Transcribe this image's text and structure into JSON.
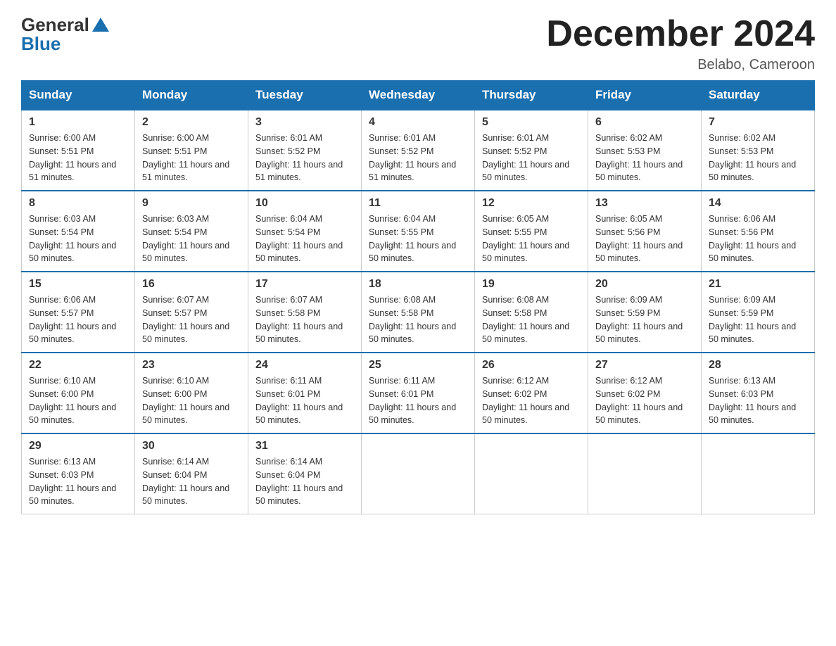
{
  "logo": {
    "general": "General",
    "blue": "Blue"
  },
  "title": "December 2024",
  "location": "Belabo, Cameroon",
  "days_of_week": [
    "Sunday",
    "Monday",
    "Tuesday",
    "Wednesday",
    "Thursday",
    "Friday",
    "Saturday"
  ],
  "weeks": [
    [
      {
        "day": "1",
        "sunrise": "6:00 AM",
        "sunset": "5:51 PM",
        "daylight": "11 hours and 51 minutes."
      },
      {
        "day": "2",
        "sunrise": "6:00 AM",
        "sunset": "5:51 PM",
        "daylight": "11 hours and 51 minutes."
      },
      {
        "day": "3",
        "sunrise": "6:01 AM",
        "sunset": "5:52 PM",
        "daylight": "11 hours and 51 minutes."
      },
      {
        "day": "4",
        "sunrise": "6:01 AM",
        "sunset": "5:52 PM",
        "daylight": "11 hours and 51 minutes."
      },
      {
        "day": "5",
        "sunrise": "6:01 AM",
        "sunset": "5:52 PM",
        "daylight": "11 hours and 50 minutes."
      },
      {
        "day": "6",
        "sunrise": "6:02 AM",
        "sunset": "5:53 PM",
        "daylight": "11 hours and 50 minutes."
      },
      {
        "day": "7",
        "sunrise": "6:02 AM",
        "sunset": "5:53 PM",
        "daylight": "11 hours and 50 minutes."
      }
    ],
    [
      {
        "day": "8",
        "sunrise": "6:03 AM",
        "sunset": "5:54 PM",
        "daylight": "11 hours and 50 minutes."
      },
      {
        "day": "9",
        "sunrise": "6:03 AM",
        "sunset": "5:54 PM",
        "daylight": "11 hours and 50 minutes."
      },
      {
        "day": "10",
        "sunrise": "6:04 AM",
        "sunset": "5:54 PM",
        "daylight": "11 hours and 50 minutes."
      },
      {
        "day": "11",
        "sunrise": "6:04 AM",
        "sunset": "5:55 PM",
        "daylight": "11 hours and 50 minutes."
      },
      {
        "day": "12",
        "sunrise": "6:05 AM",
        "sunset": "5:55 PM",
        "daylight": "11 hours and 50 minutes."
      },
      {
        "day": "13",
        "sunrise": "6:05 AM",
        "sunset": "5:56 PM",
        "daylight": "11 hours and 50 minutes."
      },
      {
        "day": "14",
        "sunrise": "6:06 AM",
        "sunset": "5:56 PM",
        "daylight": "11 hours and 50 minutes."
      }
    ],
    [
      {
        "day": "15",
        "sunrise": "6:06 AM",
        "sunset": "5:57 PM",
        "daylight": "11 hours and 50 minutes."
      },
      {
        "day": "16",
        "sunrise": "6:07 AM",
        "sunset": "5:57 PM",
        "daylight": "11 hours and 50 minutes."
      },
      {
        "day": "17",
        "sunrise": "6:07 AM",
        "sunset": "5:58 PM",
        "daylight": "11 hours and 50 minutes."
      },
      {
        "day": "18",
        "sunrise": "6:08 AM",
        "sunset": "5:58 PM",
        "daylight": "11 hours and 50 minutes."
      },
      {
        "day": "19",
        "sunrise": "6:08 AM",
        "sunset": "5:58 PM",
        "daylight": "11 hours and 50 minutes."
      },
      {
        "day": "20",
        "sunrise": "6:09 AM",
        "sunset": "5:59 PM",
        "daylight": "11 hours and 50 minutes."
      },
      {
        "day": "21",
        "sunrise": "6:09 AM",
        "sunset": "5:59 PM",
        "daylight": "11 hours and 50 minutes."
      }
    ],
    [
      {
        "day": "22",
        "sunrise": "6:10 AM",
        "sunset": "6:00 PM",
        "daylight": "11 hours and 50 minutes."
      },
      {
        "day": "23",
        "sunrise": "6:10 AM",
        "sunset": "6:00 PM",
        "daylight": "11 hours and 50 minutes."
      },
      {
        "day": "24",
        "sunrise": "6:11 AM",
        "sunset": "6:01 PM",
        "daylight": "11 hours and 50 minutes."
      },
      {
        "day": "25",
        "sunrise": "6:11 AM",
        "sunset": "6:01 PM",
        "daylight": "11 hours and 50 minutes."
      },
      {
        "day": "26",
        "sunrise": "6:12 AM",
        "sunset": "6:02 PM",
        "daylight": "11 hours and 50 minutes."
      },
      {
        "day": "27",
        "sunrise": "6:12 AM",
        "sunset": "6:02 PM",
        "daylight": "11 hours and 50 minutes."
      },
      {
        "day": "28",
        "sunrise": "6:13 AM",
        "sunset": "6:03 PM",
        "daylight": "11 hours and 50 minutes."
      }
    ],
    [
      {
        "day": "29",
        "sunrise": "6:13 AM",
        "sunset": "6:03 PM",
        "daylight": "11 hours and 50 minutes."
      },
      {
        "day": "30",
        "sunrise": "6:14 AM",
        "sunset": "6:04 PM",
        "daylight": "11 hours and 50 minutes."
      },
      {
        "day": "31",
        "sunrise": "6:14 AM",
        "sunset": "6:04 PM",
        "daylight": "11 hours and 50 minutes."
      },
      null,
      null,
      null,
      null
    ]
  ],
  "labels": {
    "sunrise_prefix": "Sunrise: ",
    "sunset_prefix": "Sunset: ",
    "daylight_prefix": "Daylight: "
  }
}
